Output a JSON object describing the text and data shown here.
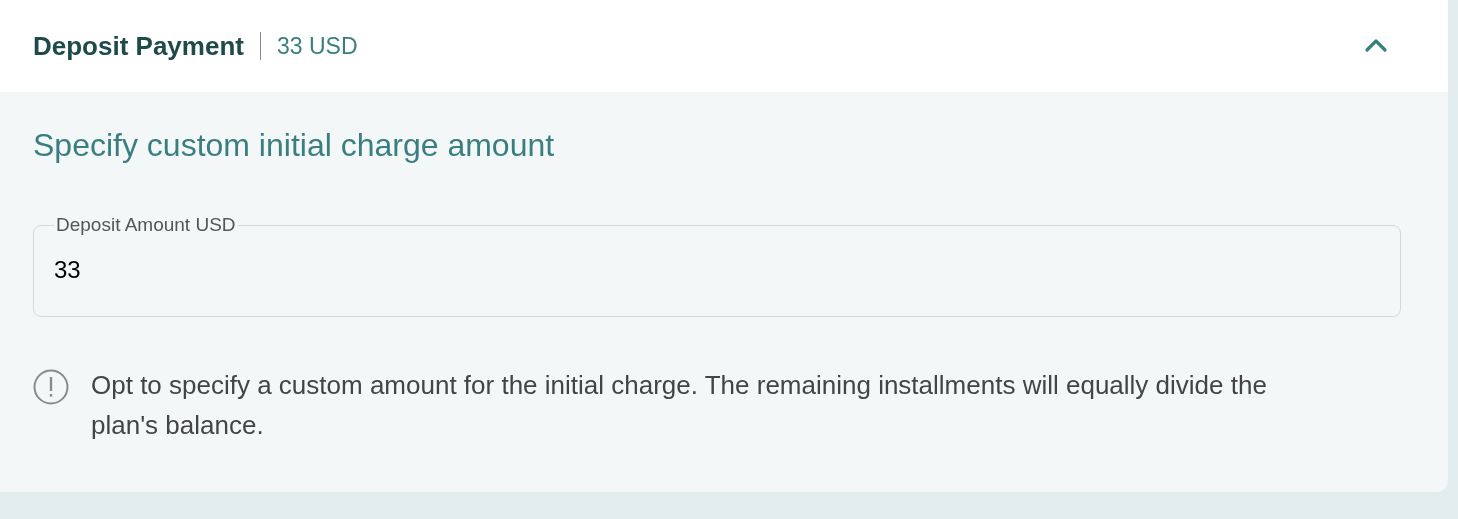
{
  "panel": {
    "title": "Deposit Payment",
    "amount": "33 USD",
    "expanded": true
  },
  "section_title": "Specify custom initial charge amount",
  "deposit_field": {
    "label": "Deposit Amount USD",
    "value": "33"
  },
  "info_text": "Opt to specify a custom amount for the initial charge. The remaining installments will equally divide the plan's balance."
}
